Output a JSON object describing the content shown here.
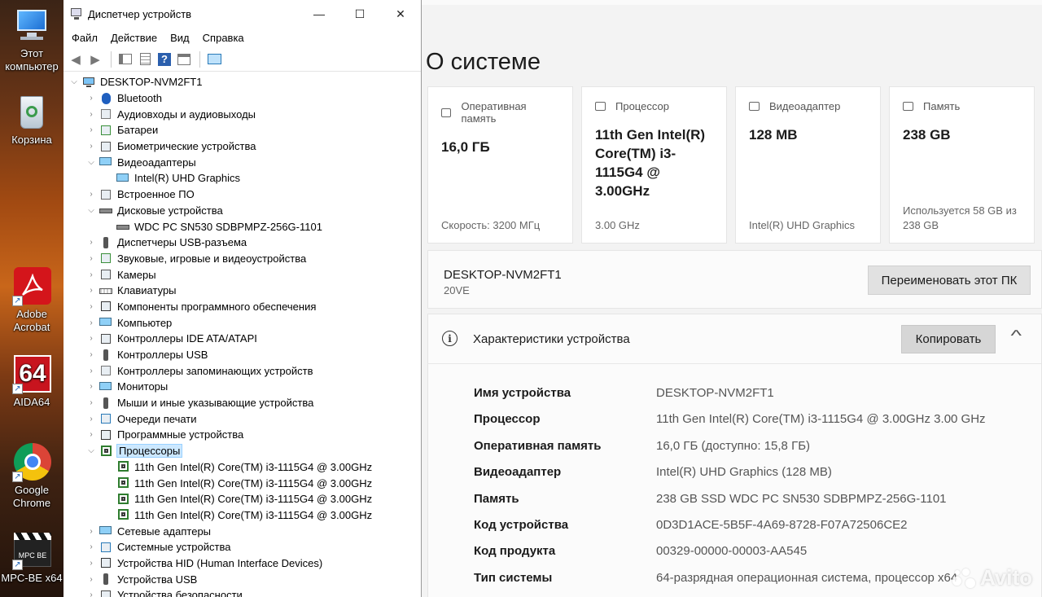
{
  "desktop": {
    "icons": [
      {
        "label": "Этот компьютер",
        "icon": "computer-icon"
      },
      {
        "label": "Корзина",
        "icon": "recycle-bin-icon"
      },
      {
        "label": "Adobe Acrobat",
        "icon": "adobe-acrobat-icon"
      },
      {
        "label": "AIDA64",
        "icon": "aida64-icon",
        "glyph_text": "64"
      },
      {
        "label": "Google Chrome",
        "icon": "chrome-icon"
      },
      {
        "label": "MPC-BE x64",
        "icon": "mpc-be-icon",
        "glyph_text": "MPC BE"
      }
    ],
    "shortcut_glyph": "↗"
  },
  "device_manager": {
    "title": "Диспетчер устройств",
    "window_buttons": {
      "minimize": "—",
      "maximize": "☐",
      "close": "✕"
    },
    "menu": [
      "Файл",
      "Действие",
      "Вид",
      "Справка"
    ],
    "toolbar": {
      "back": "◀",
      "forward": "▶",
      "help": "?"
    },
    "tree_root": "DESKTOP-NVM2FT1",
    "tree": [
      {
        "label": "Bluetooth",
        "icon": "bluetooth-icon",
        "level": 1,
        "expanded": false
      },
      {
        "label": "Аудиовходы и аудиовыходы",
        "icon": "audio-io-icon",
        "level": 1,
        "expanded": false
      },
      {
        "label": "Батареи",
        "icon": "battery-icon",
        "level": 1,
        "expanded": false
      },
      {
        "label": "Биометрические устройства",
        "icon": "biometric-icon",
        "level": 1,
        "expanded": false
      },
      {
        "label": "Видеоадаптеры",
        "icon": "display-adapter-icon",
        "level": 1,
        "expanded": true
      },
      {
        "label": "Intel(R) UHD Graphics",
        "icon": "display-adapter-icon",
        "level": 2
      },
      {
        "label": "Встроенное ПО",
        "icon": "firmware-icon",
        "level": 1,
        "expanded": false
      },
      {
        "label": "Дисковые устройства",
        "icon": "disk-drive-icon",
        "level": 1,
        "expanded": true
      },
      {
        "label": "WDC PC SN530 SDBPMPZ-256G-1101",
        "icon": "disk-drive-icon",
        "level": 2
      },
      {
        "label": "Диспетчеры USB-разъема",
        "icon": "usb-connector-icon",
        "level": 1,
        "expanded": false
      },
      {
        "label": "Звуковые, игровые и видеоустройства",
        "icon": "speaker-icon",
        "level": 1,
        "expanded": false
      },
      {
        "label": "Камеры",
        "icon": "camera-icon",
        "level": 1,
        "expanded": false
      },
      {
        "label": "Клавиатуры",
        "icon": "keyboard-icon",
        "level": 1,
        "expanded": false
      },
      {
        "label": "Компоненты программного обеспечения",
        "icon": "software-component-icon",
        "level": 1,
        "expanded": false
      },
      {
        "label": "Компьютер",
        "icon": "computer-icon",
        "level": 1,
        "expanded": false
      },
      {
        "label": "Контроллеры IDE ATA/ATAPI",
        "icon": "ide-controller-icon",
        "level": 1,
        "expanded": false
      },
      {
        "label": "Контроллеры USB",
        "icon": "usb-icon",
        "level": 1,
        "expanded": false
      },
      {
        "label": "Контроллеры запоминающих устройств",
        "icon": "storage-controller-icon",
        "level": 1,
        "expanded": false
      },
      {
        "label": "Мониторы",
        "icon": "monitor-icon",
        "level": 1,
        "expanded": false
      },
      {
        "label": "Мыши и иные указывающие устройства",
        "icon": "mouse-icon",
        "level": 1,
        "expanded": false
      },
      {
        "label": "Очереди печати",
        "icon": "printer-icon",
        "level": 1,
        "expanded": false
      },
      {
        "label": "Программные устройства",
        "icon": "software-device-icon",
        "level": 1,
        "expanded": false
      },
      {
        "label": "Процессоры",
        "icon": "processor-icon",
        "level": 1,
        "expanded": true,
        "selected": true
      },
      {
        "label": "11th Gen Intel(R) Core(TM) i3-1115G4 @ 3.00GHz",
        "icon": "processor-icon",
        "level": 2
      },
      {
        "label": "11th Gen Intel(R) Core(TM) i3-1115G4 @ 3.00GHz",
        "icon": "processor-icon",
        "level": 2
      },
      {
        "label": "11th Gen Intel(R) Core(TM) i3-1115G4 @ 3.00GHz",
        "icon": "processor-icon",
        "level": 2
      },
      {
        "label": "11th Gen Intel(R) Core(TM) i3-1115G4 @ 3.00GHz",
        "icon": "processor-icon",
        "level": 2
      },
      {
        "label": "Сетевые адаптеры",
        "icon": "network-adapter-icon",
        "level": 1,
        "expanded": false
      },
      {
        "label": "Системные устройства",
        "icon": "system-device-icon",
        "level": 1,
        "expanded": false
      },
      {
        "label": "Устройства HID (Human Interface Devices)",
        "icon": "hid-icon",
        "level": 1,
        "expanded": false
      },
      {
        "label": "Устройства USB",
        "icon": "usb-icon",
        "level": 1,
        "expanded": false
      },
      {
        "label": "Устройства безопасности",
        "icon": "security-device-icon",
        "level": 1,
        "expanded": false
      }
    ]
  },
  "settings": {
    "page_title": "О системе",
    "cards": [
      {
        "label": "Оперативная память",
        "icon": "ram-icon",
        "value": "16,0 ГБ",
        "footer": "Скорость: 3200 МГц"
      },
      {
        "label": "Процессор",
        "icon": "processor-icon",
        "value": "11th Gen Intel(R) Core(TM) i3-1115G4 @ 3.00GHz",
        "footer": "3.00 GHz"
      },
      {
        "label": "Видеоадаптер",
        "icon": "gpu-icon",
        "value": "128 MB",
        "footer": "Intel(R) UHD Graphics"
      },
      {
        "label": "Память",
        "icon": "storage-icon",
        "value": "238 GB",
        "footer": "Используется 58 GB из 238 GB"
      }
    ],
    "pc_name": "DESKTOP-NVM2FT1",
    "pc_model": "20VE",
    "rename_button": "Переименовать этот ПК",
    "specs": {
      "title": "Характеристики устройства",
      "info_glyph": "i",
      "copy_button": "Копировать",
      "collapse_glyph": "^",
      "rows": [
        {
          "key": "Имя устройства",
          "value": "DESKTOP-NVM2FT1"
        },
        {
          "key": "Процессор",
          "value": "11th Gen Intel(R) Core(TM) i3-1115G4 @ 3.00GHz   3.00 GHz"
        },
        {
          "key": "Оперативная память",
          "value": "16,0 ГБ (доступно: 15,8 ГБ)"
        },
        {
          "key": "Видеоадаптер",
          "value": "Intel(R) UHD Graphics (128 MB)"
        },
        {
          "key": "Память",
          "value": "238 GB SSD WDC PC SN530 SDBPMPZ-256G-1101"
        },
        {
          "key": "Код устройства",
          "value": "0D3D1ACE-5B5F-4A69-8728-F07A72506CE2"
        },
        {
          "key": "Код продукта",
          "value": "00329-00000-00003-AA545"
        },
        {
          "key": "Тип системы",
          "value": "64-разрядная операционная система, процессор x64"
        }
      ]
    }
  },
  "watermark": {
    "text": "Avito"
  },
  "colors": {
    "selection_bg": "#cce8ff",
    "settings_bg": "#f3f3f3",
    "button_gray": "#e1e1e1",
    "adobe_red": "#d4151b",
    "aida_red": "#c8141e"
  }
}
